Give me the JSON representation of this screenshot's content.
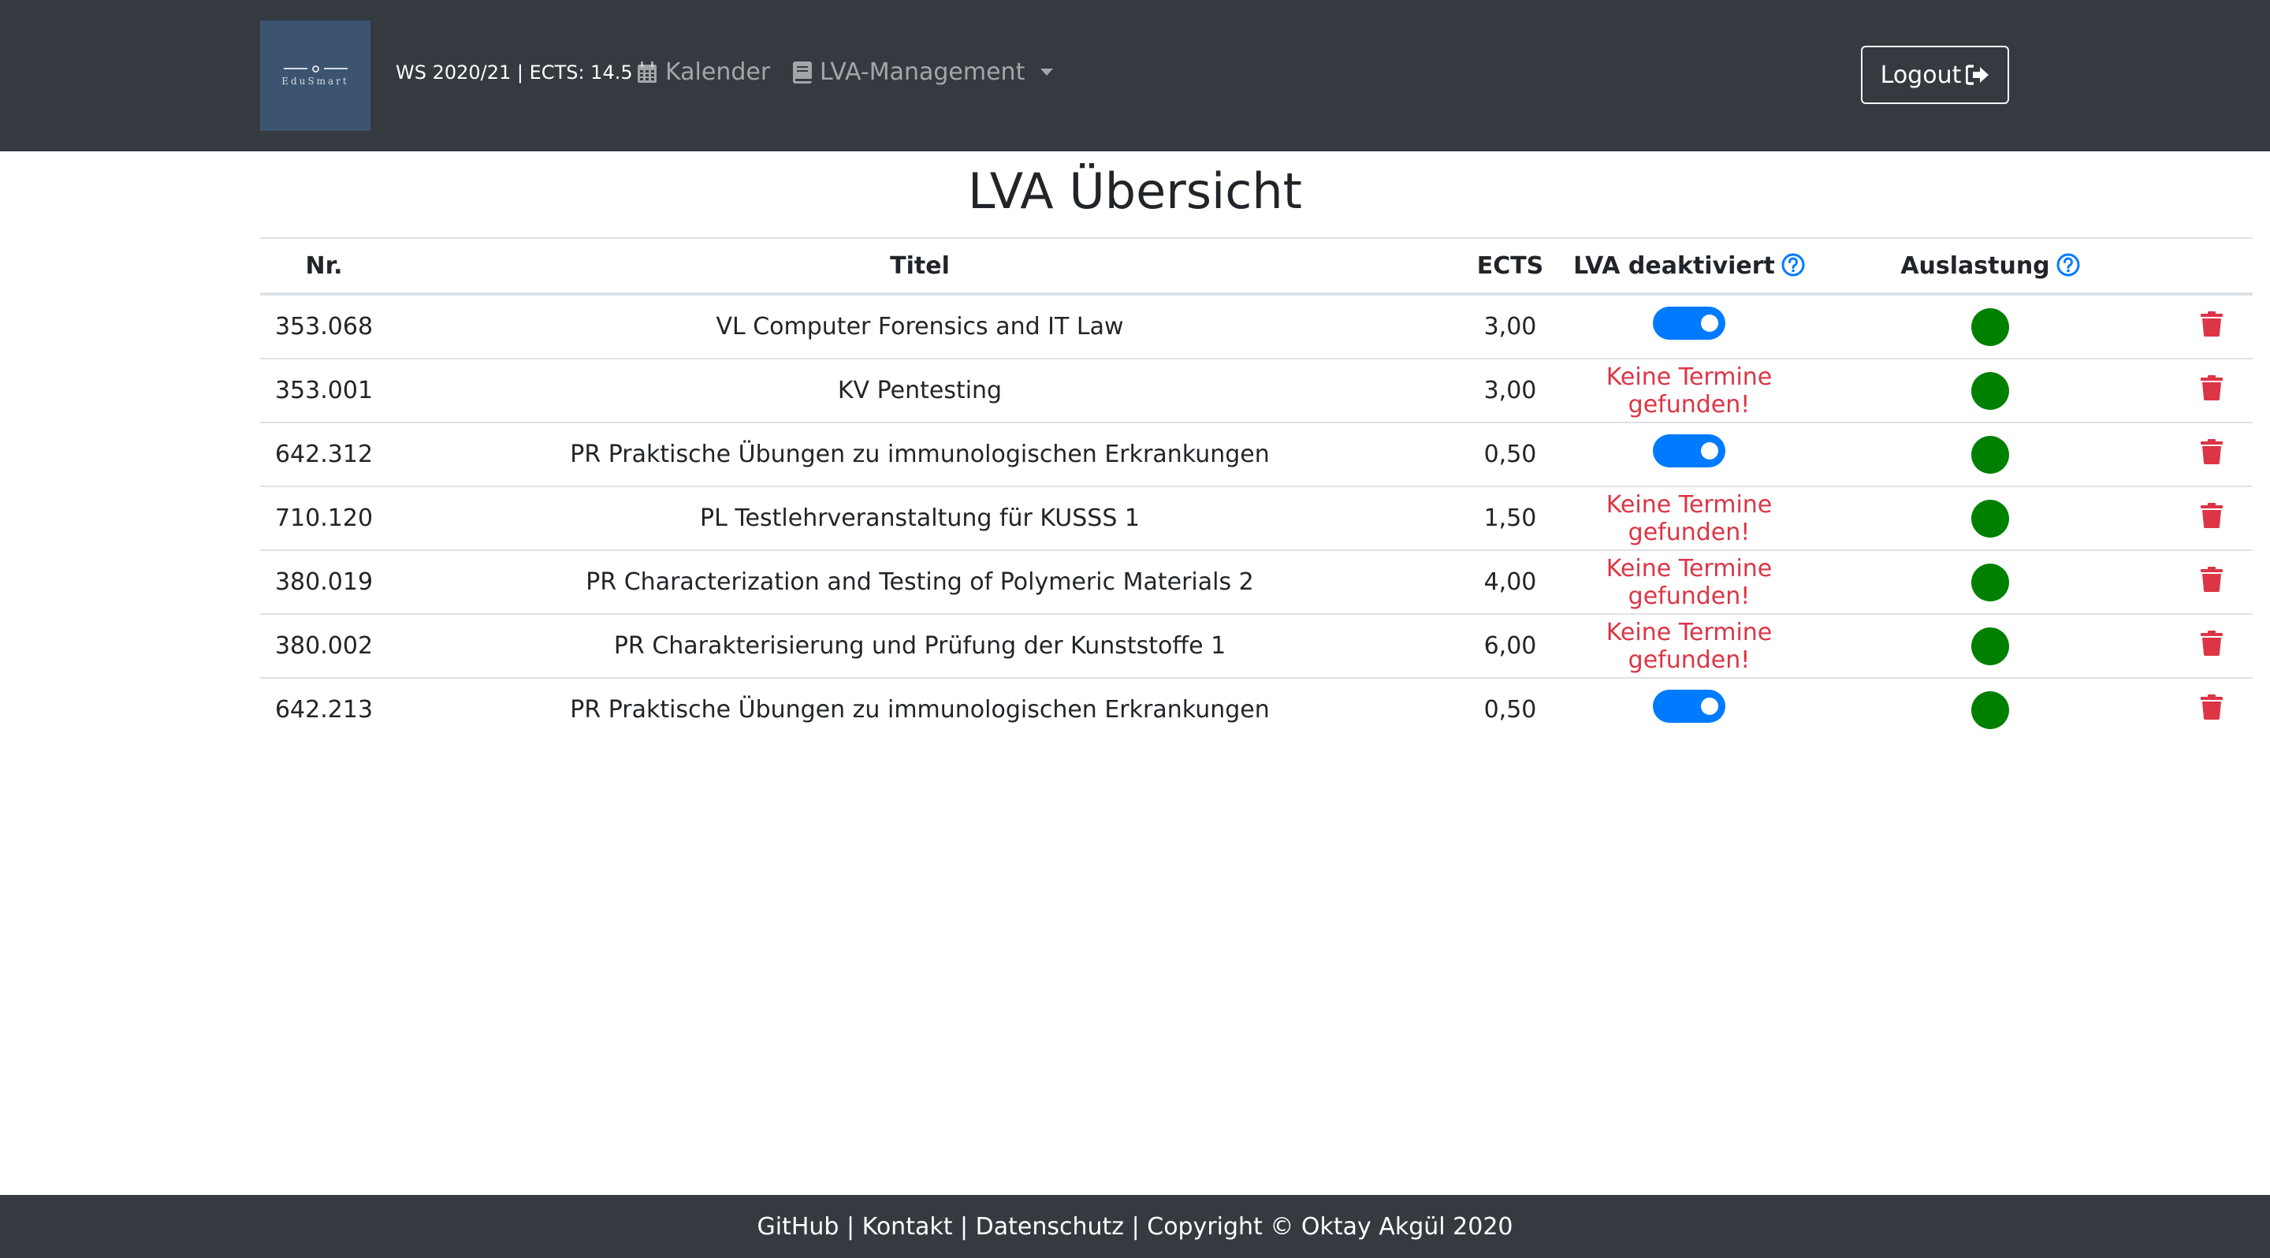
{
  "brand": {
    "logo_text": "EduSmart",
    "semester_info": "WS 2020/21 | ECTS: 14.5"
  },
  "nav": {
    "calendar_label": "Kalender",
    "lva_management_label": "LVA-Management",
    "logout_label": "Logout"
  },
  "page": {
    "title": "LVA Übersicht"
  },
  "table": {
    "headers": {
      "nr": "Nr.",
      "titel": "Titel",
      "ects": "ECTS",
      "deaktiviert": "LVA deaktiviert",
      "auslastung": "Auslastung"
    },
    "rows": [
      {
        "nr": "353.068",
        "titel": "VL Computer Forensics and IT Law",
        "ects": "3,00",
        "deaktiviert": "toggle",
        "toggle_on": true,
        "auslastung_color": "#008000"
      },
      {
        "nr": "353.001",
        "titel": "KV Pentesting",
        "ects": "3,00",
        "deaktiviert": "Keine Termine gefunden!",
        "toggle_on": null,
        "auslastung_color": "#008000"
      },
      {
        "nr": "642.312",
        "titel": "PR Praktische Übungen zu immunologischen Erkrankungen",
        "ects": "0,50",
        "deaktiviert": "toggle",
        "toggle_on": true,
        "auslastung_color": "#008000"
      },
      {
        "nr": "710.120",
        "titel": "PL Testlehrveranstaltung für KUSSS 1",
        "ects": "1,50",
        "deaktiviert": "Keine Termine gefunden!",
        "toggle_on": null,
        "auslastung_color": "#008000"
      },
      {
        "nr": "380.019",
        "titel": "PR Characterization and Testing of Polymeric Materials 2",
        "ects": "4,00",
        "deaktiviert": "Keine Termine gefunden!",
        "toggle_on": null,
        "auslastung_color": "#008000"
      },
      {
        "nr": "380.002",
        "titel": "PR Charakterisierung und Prüfung der Kunststoffe 1",
        "ects": "6,00",
        "deaktiviert": "Keine Termine gefunden!",
        "toggle_on": null,
        "auslastung_color": "#008000"
      },
      {
        "nr": "642.213",
        "titel": "PR Praktische Übungen zu immunologischen Erkrankungen",
        "ects": "0,50",
        "deaktiviert": "toggle",
        "toggle_on": true,
        "auslastung_color": "#008000"
      }
    ]
  },
  "footer": {
    "github": "GitHub",
    "sep": " | ",
    "kontakt": "Kontakt",
    "datenschutz": "Datenschutz",
    "copyright": "Copyright © Oktay Akgül 2020"
  },
  "colors": {
    "navbar": "#343a40",
    "accent": "#007bff",
    "danger": "#dc3545",
    "status_ok": "#008000"
  }
}
